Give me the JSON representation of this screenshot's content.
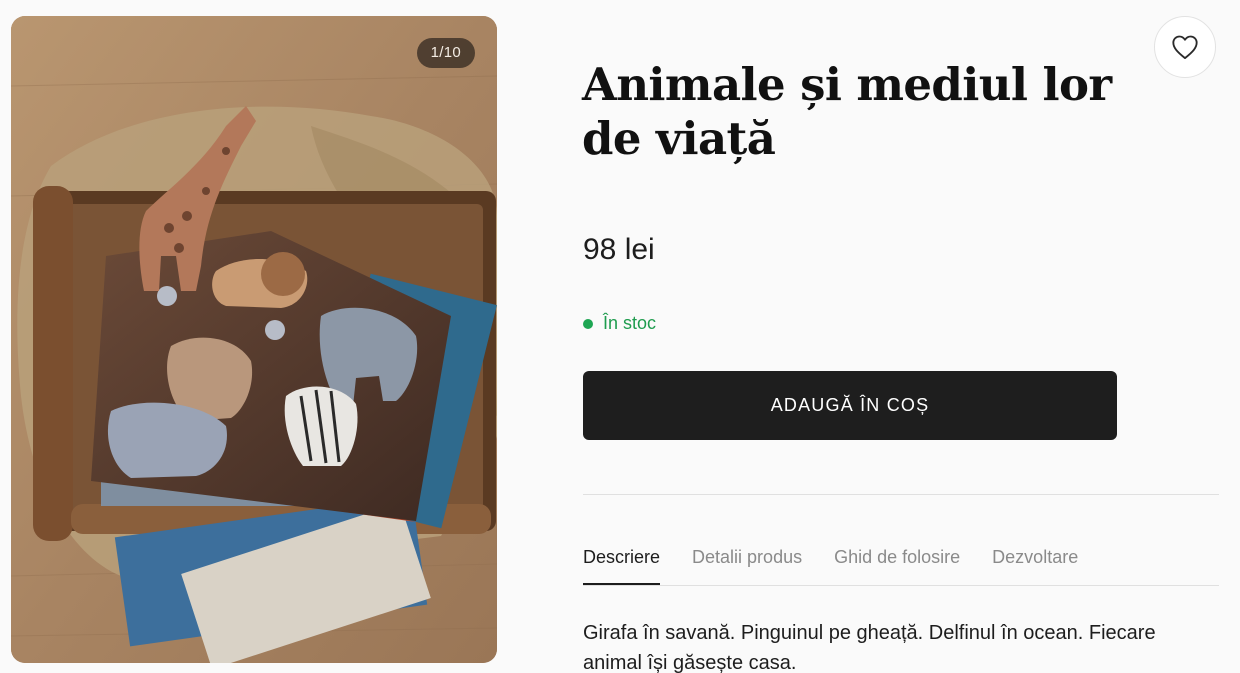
{
  "gallery": {
    "counter": "1/10",
    "image_alt": "Animale și mediul lor de viață"
  },
  "product": {
    "title": "Animale și mediul lor de viață",
    "price": "98 lei",
    "stock": "În stoc",
    "add_to_cart": "ADAUGĂ ÎN COȘ",
    "wishlist_icon": "heart-icon"
  },
  "tabs": [
    {
      "label": "Descriere",
      "active": true
    },
    {
      "label": "Detalii produs",
      "active": false
    },
    {
      "label": "Ghid de folosire",
      "active": false
    },
    {
      "label": "Dezvoltare",
      "active": false
    }
  ],
  "description": "Girafa în savană. Pinguinul pe gheață. Delfinul în ocean. Fiecare animal își găsește casa.",
  "colors": {
    "accent": "#1e1e1e",
    "stock_green": "#1ea653",
    "background": "#fafafa"
  }
}
